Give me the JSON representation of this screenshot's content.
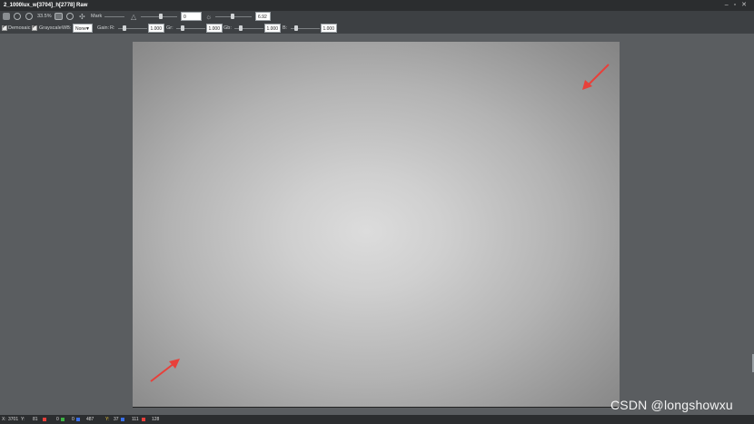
{
  "window": {
    "title": "2_1000lux_w[3704]_h[2778] Raw",
    "controls": [
      "–",
      "▫",
      "✕"
    ]
  },
  "toolbar1": {
    "zoom_label": "33.5%",
    "mark_label": "Mark",
    "contrast_value": "0",
    "brightness_value": "6.92"
  },
  "toolbar2": {
    "demosaic_label": "Demosaic",
    "grayscale_label": "Grayscale",
    "wb_label": "WB:",
    "wb_value": "None",
    "gain_label": "Gain:",
    "r_label": "R:",
    "r_value": "1.000",
    "gr_label": "Gr:",
    "gr_value": "1.000",
    "gb_label": "Gb:",
    "gb_value": "1.000",
    "b_label": "B:",
    "b_value": "1.000"
  },
  "status": {
    "x_label": "X:",
    "x_value": "3701",
    "y_label": "Y:",
    "y_value": "81",
    "r_value": "0",
    "g_value": "0",
    "b_value": "487",
    "yy_label": "Y:",
    "yy_value": "37",
    "cb_value": "111",
    "cr_value": "128"
  },
  "watermark": "CSDN @longshowxu",
  "colors": {
    "titlebar": "#2b2d2f",
    "toolbar": "#3d4043",
    "canvas": "#5a5d60",
    "arrow": "#e8403a"
  }
}
